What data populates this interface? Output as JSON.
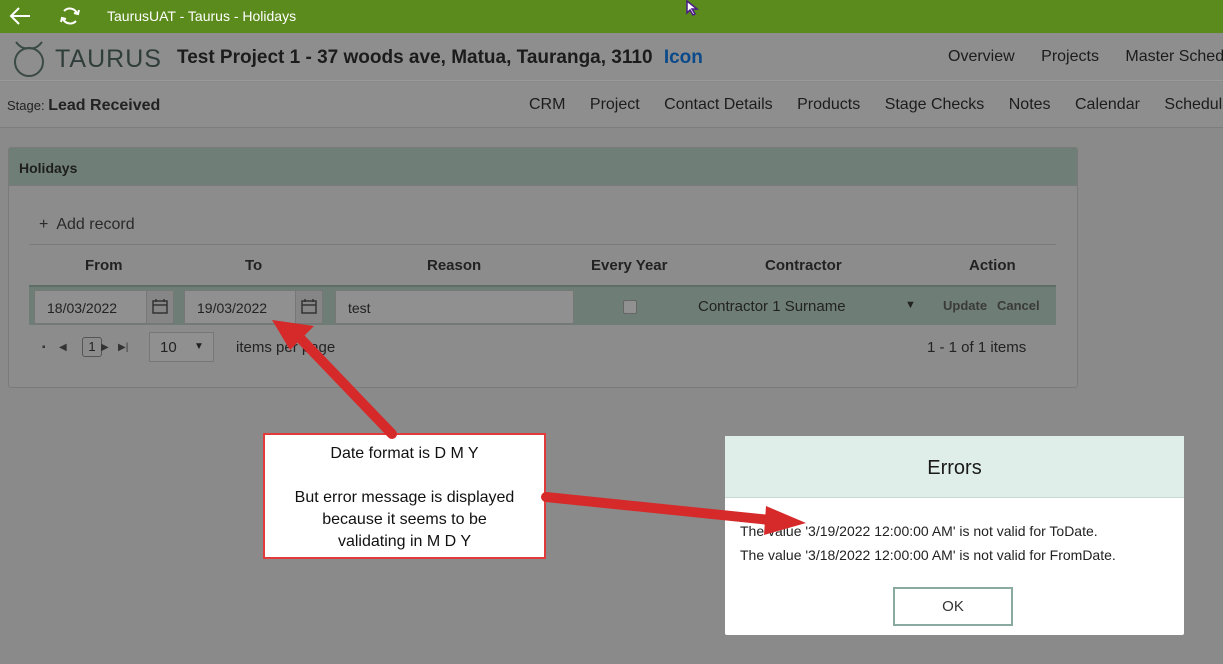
{
  "titlebar": {
    "title": "TaurusUAT - Taurus - Holidays"
  },
  "header": {
    "brand": "TAURUS",
    "project_title": "Test Project 1 - 37 woods ave, Matua, Tauranga, 3110",
    "icon_link": "Icon",
    "nav": [
      "Overview",
      "Projects",
      "Master Schedule"
    ]
  },
  "stage": {
    "label": "Stage:",
    "value": "Lead Received",
    "nav": [
      "CRM",
      "Project",
      "Contact Details",
      "Products",
      "Stage Checks",
      "Notes",
      "Calendar",
      "Schedule"
    ]
  },
  "holidays": {
    "title": "Holidays",
    "add_record": "Add record",
    "columns": {
      "from": "From",
      "to": "To",
      "reason": "Reason",
      "every_year": "Every Year",
      "contractor": "Contractor",
      "action": "Action"
    },
    "edit_row": {
      "from": "18/03/2022",
      "to": "19/03/2022",
      "reason": "test",
      "every_year": false,
      "contractor": "Contractor 1 Surname",
      "update": "Update",
      "cancel": "Cancel"
    },
    "pager": {
      "page": "1",
      "page_size": "10",
      "items_label": "items per page",
      "info": "1 - 1 of 1 items"
    }
  },
  "dialog": {
    "title": "Errors",
    "messages": [
      "The value '3/19/2022 12:00:00 AM' is not valid for ToDate.",
      "The value '3/18/2022 12:00:00 AM' is not valid for FromDate."
    ],
    "ok": "OK"
  },
  "callout": {
    "line1": "Date format is D M Y",
    "line2": "But error message is displayed",
    "line3": "because it seems to be",
    "line4": "validating in M D Y"
  },
  "colors": {
    "titlebar": "#5b8a1d",
    "annotation": "#e03a3a",
    "dialog_header": "#dfeee9"
  }
}
